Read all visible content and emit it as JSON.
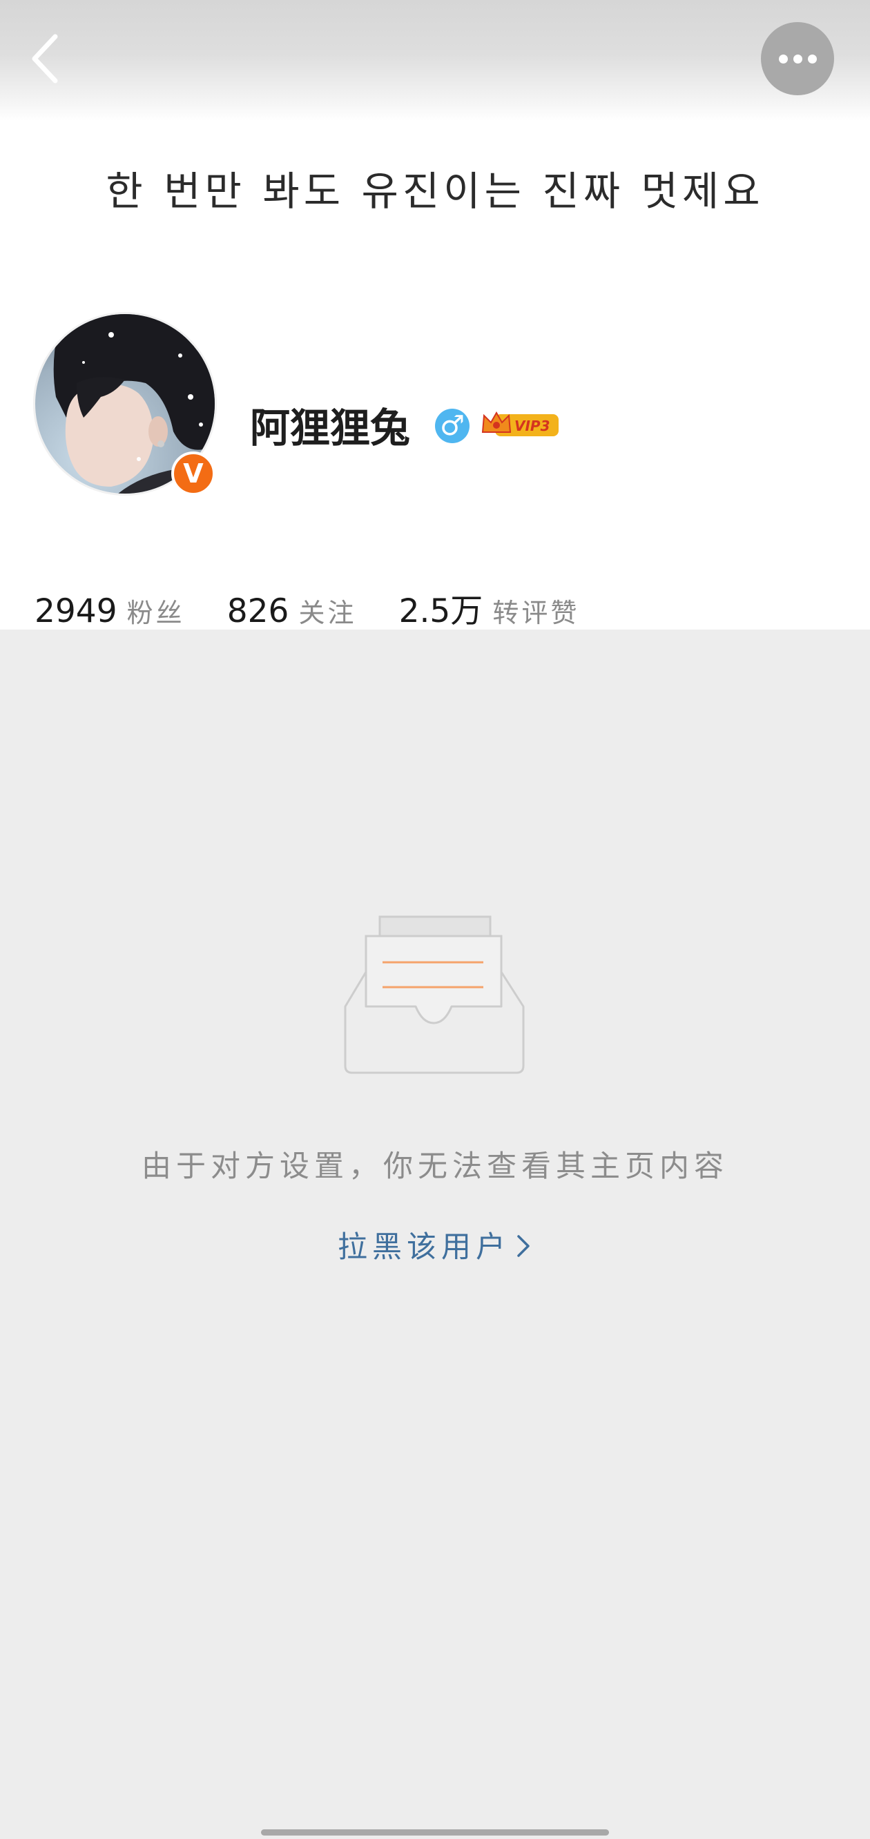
{
  "header": {
    "back_icon": "chevron-left-icon",
    "more_icon": "more-horizontal-icon"
  },
  "cover": {
    "text": "한 번만 봐도 유진이는 진짜 멋제요"
  },
  "profile": {
    "username": "阿狸狸兔",
    "gender_symbol": "♂",
    "verified_symbol": "V",
    "vip_label": "VIP3",
    "colors": {
      "verified_badge": "#f36c14",
      "gender_badge": "#4fb6f0",
      "vip_gold": "#f3b21b",
      "vip_red": "#d4341f"
    }
  },
  "stats": [
    {
      "value": "2949",
      "label": "粉丝"
    },
    {
      "value": "826",
      "label": "关注"
    },
    {
      "value": "2.5万",
      "label": "转评赞"
    }
  ],
  "empty_state": {
    "message": "由于对方设置，你无法查看其主页内容",
    "action_label": "拉黑该用户",
    "action_color": "#3f6f9d"
  }
}
